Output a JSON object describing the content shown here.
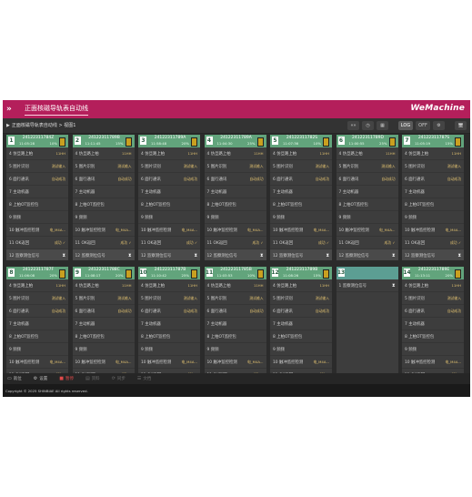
{
  "header": {
    "title": "正面核磁导轨表自动线",
    "brand": "WeMachine",
    "menu_icon": "double-chevron-right-icon"
  },
  "breadcrumb": "正面核磁导轨表自动线 > 视图1",
  "toolbar": {
    "buttons": [
      "«»",
      "◷",
      "▦",
      "LOG",
      "OFF",
      "⚙",
      "🖥"
    ]
  },
  "labels": {
    "r4": "4 仿旦路上柏",
    "r5": "5 图片识别",
    "r6": "6 面行通讯",
    "r7": "7 主动机器",
    "r8": "8 上柏OT监控包",
    "r9": "9 频频",
    "r10": "10 触冲监控检测",
    "r11": "11 OK返回",
    "r12": "12 监察测位信号",
    "r1": "1 监察测位信号"
  },
  "values": {
    "v4": "11HH",
    "v5": "测试输入",
    "v6": "自动成功",
    "v10": "电_M4A...",
    "v11": "成功 ✓"
  },
  "cards": [
    {
      "num": "1",
      "code": "24122311784Z",
      "t1": "11:05:28",
      "t2": "10%"
    },
    {
      "num": "2",
      "code": "24122311789B",
      "t1": "11:11:45",
      "t2": "15%"
    },
    {
      "num": "3",
      "code": "24122311789A",
      "t1": "11:58:48",
      "t2": "20%"
    },
    {
      "num": "4",
      "code": "24122311789A",
      "t1": "11:04:30",
      "t2": "25%"
    },
    {
      "num": "5",
      "code": "24122311782S",
      "t1": "11:07:36",
      "t2": "10%"
    },
    {
      "num": "6",
      "code": "24122311789D",
      "t1": "11:00:55",
      "t2": "25%"
    },
    {
      "num": "7",
      "code": "24122311787S",
      "t1": "11:05:19",
      "t2": "15%"
    },
    {
      "num": "8",
      "code": "24122311787F",
      "t1": "11:06:08",
      "t2": "20%"
    },
    {
      "num": "9",
      "code": "24122311788C",
      "t1": "11:08:17",
      "t2": "20%"
    },
    {
      "num": "10",
      "code": "24122311787B",
      "t1": "11:10:42",
      "t2": "25%"
    },
    {
      "num": "11",
      "code": "24122311785B",
      "t1": "11:03:53",
      "t2": "10%"
    },
    {
      "num": "12",
      "code": "24122311789B",
      "t1": "11:08:26",
      "t2": "15%"
    },
    {
      "num": "13",
      "code": "",
      "t1": "",
      "t2": ""
    },
    {
      "num": "14",
      "code": "24122311789E",
      "t1": "11:13:11",
      "t2": "20%"
    }
  ],
  "bottom": [
    {
      "icon": "monitor-icon",
      "sym": "▭",
      "label": "就位"
    },
    {
      "icon": "gear-icon",
      "sym": "⚙",
      "label": "设置"
    },
    {
      "icon": "stop-icon",
      "sym": "■",
      "label": "暂停"
    },
    {
      "icon": "doc-icon",
      "sym": "▤",
      "label": "资料"
    },
    {
      "icon": "sync-icon",
      "sym": "⟳",
      "label": "同步"
    },
    {
      "icon": "list-icon",
      "sym": "☰",
      "label": "文档"
    }
  ],
  "footer": "Copyright © 2025 SHINBIAE All rights reserved.",
  "colors": {
    "title_bar": "#b41f5b",
    "card_head": "#62a47c",
    "background": "#2b2b2b"
  }
}
